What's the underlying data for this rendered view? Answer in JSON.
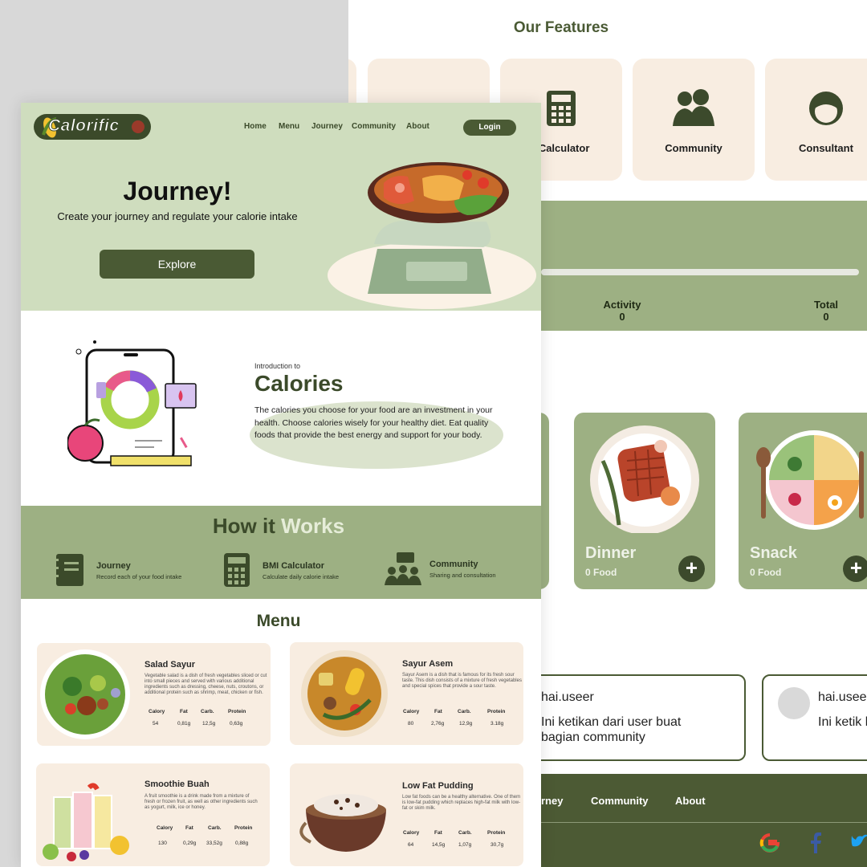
{
  "back": {
    "features_title": "Our Features",
    "features": [
      {
        "label": "",
        "icon": "document-icon"
      },
      {
        "label": "I Calculator",
        "icon": "calculator-icon"
      },
      {
        "label": "Community",
        "icon": "community-icon"
      },
      {
        "label": "Consultant",
        "icon": "headset-icon"
      }
    ],
    "stats": [
      {
        "label": "Activity",
        "value": "0"
      },
      {
        "label": "Total",
        "value": "0"
      }
    ],
    "meals": [
      {
        "name": "Dinner",
        "count": "0 Food",
        "add": "+"
      },
      {
        "name": "Snack",
        "count": "0 Food",
        "add": "+"
      }
    ],
    "posts": [
      {
        "user": "hai.useer",
        "text": "Ini ketikan dari user buat bagian community"
      },
      {
        "user": "hai.useer",
        "text": "Ini ketik bagian c"
      }
    ],
    "footer_links": [
      "rney",
      "Community",
      "About"
    ],
    "social_icons": [
      "google-icon",
      "facebook-icon",
      "twitter-icon"
    ]
  },
  "front": {
    "logo": "Calorific",
    "nav": [
      "Home",
      "Menu",
      "Journey",
      "Community",
      "About"
    ],
    "login": "Login",
    "hero": {
      "title": "Journey!",
      "subtitle": "Create your journey and regulate your calorie intake",
      "button": "Explore"
    },
    "intro": {
      "small": "Introduction to",
      "title": "Calories",
      "body": "The calories you choose for your food are an investment in your health. Choose calories wisely for your healthy diet. Eat quality foods that provide the best energy and support for your body."
    },
    "how": {
      "title_a": "How it",
      "title_b": "Works",
      "items": [
        {
          "title": "Journey",
          "desc": "Record each of your food intake",
          "icon": "notebook-icon"
        },
        {
          "title": "BMI Calculator",
          "desc": "Calculate daily calorie intake",
          "icon": "calculator-icon"
        },
        {
          "title": "Community",
          "desc": "Sharing and consultation",
          "icon": "group-chat-icon"
        }
      ]
    },
    "menu_title": "Menu",
    "nutrient_headers": [
      "Calory",
      "Fat",
      "Carb.",
      "Protein"
    ],
    "menu": [
      {
        "name": "Salad Sayur",
        "desc": "Vegetable salad is a dish of fresh vegetables sliced or cut into small pieces and served with various additional ingredients such as dressing, cheese, nuts, croutons, or additional protein such as shrimp, meat, chicken or fish.",
        "values": [
          "54",
          "0,81g",
          "12,5g",
          "0,63g"
        ]
      },
      {
        "name": "Sayur Asem",
        "desc": "Sayur Asem is a dish that is famous for its fresh sour taste. This dish consists of a mixture of fresh vegetables and special spices that provide a sour taste.",
        "values": [
          "80",
          "2,76g",
          "12,9g",
          "3.18g"
        ]
      },
      {
        "name": "Smoothie Buah",
        "desc": "A fruit smoothie is a drink made from a mixture of fresh or frozen fruit, as well as other ingredients such as yogurt, milk, ice or honey.",
        "values": [
          "130",
          "0,29g",
          "33,52g",
          "0,88g"
        ]
      },
      {
        "name": "Low Fat Pudding",
        "desc": "Low fat foods can be a healthy alternative. One of them is low-fat pudding which replaces high-fat milk with low-fat or skim milk.",
        "values": [
          "64",
          "14,5g",
          "1,07g",
          "30,7g"
        ]
      }
    ]
  },
  "colors": {
    "primary": "#4a5a34",
    "sage": "#9db083",
    "light_sage": "#cfddbe",
    "cream": "#f8ede1"
  }
}
